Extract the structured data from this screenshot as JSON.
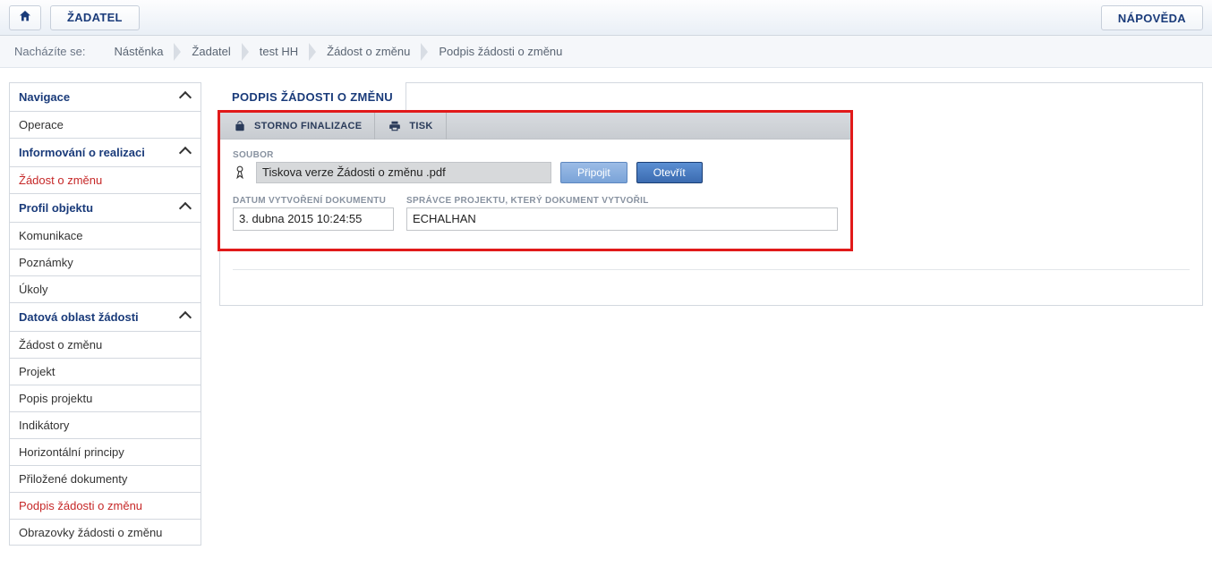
{
  "topbar": {
    "applicant_tab": "ŽADATEL",
    "help_button": "NÁPOVĚDA"
  },
  "breadcrumb": {
    "label": "Nacházíte se:",
    "items": [
      "Nástěnka",
      "Žadatel",
      "test HH",
      "Žádost o změnu",
      "Podpis žádosti o změnu"
    ]
  },
  "sidebar": {
    "groups": [
      {
        "title": "Navigace",
        "items": [
          {
            "label": "Operace",
            "red": false
          }
        ]
      },
      {
        "title": "Informování o realizaci",
        "items": [
          {
            "label": "Žádost o změnu",
            "red": true
          }
        ]
      },
      {
        "title": "Profil objektu",
        "items": [
          {
            "label": "Komunikace",
            "red": false
          },
          {
            "label": "Poznámky",
            "red": false
          },
          {
            "label": "Úkoly",
            "red": false
          }
        ]
      },
      {
        "title": "Datová oblast žádosti",
        "items": [
          {
            "label": "Žádost o změnu",
            "red": false
          },
          {
            "label": "Projekt",
            "red": false
          },
          {
            "label": "Popis projektu",
            "red": false
          },
          {
            "label": "Indikátory",
            "red": false
          },
          {
            "label": "Horizontální principy",
            "red": false
          },
          {
            "label": "Přiložené dokumenty",
            "red": false
          },
          {
            "label": "Podpis žádosti o změnu",
            "red": true
          },
          {
            "label": "Obrazovky žádosti o změnu",
            "red": false
          }
        ]
      }
    ]
  },
  "main": {
    "title": "PODPIS ŽÁDOSTI O ZMĚNU",
    "actions": {
      "storno": "STORNO FINALIZACE",
      "print": "TISK"
    },
    "file": {
      "label": "SOUBOR",
      "value": "Tiskova verze Žádosti o změnu .pdf",
      "attach_btn": "Připojit",
      "open_btn": "Otevřít"
    },
    "date": {
      "label": "DATUM VYTVOŘENÍ DOKUMENTU",
      "value": "3. dubna 2015 10:24:55"
    },
    "admin": {
      "label": "SPRÁVCE PROJEKTU, KTERÝ DOKUMENT VYTVOŘIL",
      "value": "ECHALHAN"
    }
  }
}
